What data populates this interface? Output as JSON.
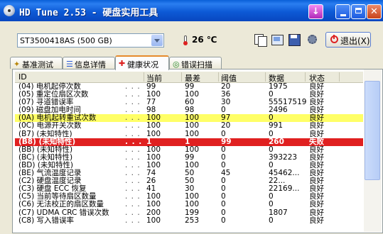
{
  "window": {
    "title": "HD Tune 2.53 - 硬盘实用工具",
    "icon": "disk-icon",
    "colors": {
      "titlebar": "#0a5fd8",
      "accent": "#e68b2c",
      "highlight_warn": "#ffff66",
      "highlight_bad": "#e02020"
    }
  },
  "toolbar": {
    "drive": "ST3500418AS (500 GB)",
    "temperature": "26 ℃",
    "exit_label": "退出(X)"
  },
  "tabs": [
    {
      "label": "基准测试",
      "icon": "benchmark-icon"
    },
    {
      "label": "信息详情",
      "icon": "info-icon"
    },
    {
      "label": "健康状况",
      "icon": "health-icon",
      "active": true
    },
    {
      "label": "错误扫描",
      "icon": "scan-icon"
    }
  ],
  "table": {
    "columns": [
      "ID",
      "当前",
      "最差",
      "阈值",
      "数据",
      "状态"
    ],
    "rows": [
      {
        "id": "(04) 电机起停次数",
        "cur": "99",
        "worst": "99",
        "thr": "20",
        "data": "1975",
        "status": "良好",
        "hl": ""
      },
      {
        "id": "(05) 重定位扇区次数",
        "cur": "100",
        "worst": "100",
        "thr": "36",
        "data": "0",
        "status": "良好",
        "hl": ""
      },
      {
        "id": "(07) 寻道错误率",
        "cur": "77",
        "worst": "60",
        "thr": "30",
        "data": "55517519",
        "status": "良好",
        "hl": ""
      },
      {
        "id": "(09) 磁盘加电时间",
        "cur": "98",
        "worst": "98",
        "thr": "0",
        "data": "2496",
        "status": "良好",
        "hl": ""
      },
      {
        "id": "(0A) 电机起转重试次数",
        "cur": "100",
        "worst": "100",
        "thr": "97",
        "data": "0",
        "status": "良好",
        "hl": "yellow"
      },
      {
        "id": "(0C) 电源开关次数",
        "cur": "100",
        "worst": "100",
        "thr": "20",
        "data": "991",
        "status": "良好",
        "hl": ""
      },
      {
        "id": "(B7) (未知特性)",
        "cur": "100",
        "worst": "100",
        "thr": "0",
        "data": "0",
        "status": "良好",
        "hl": ""
      },
      {
        "id": "(B8) (未知特性)",
        "cur": "1",
        "worst": "1",
        "thr": "99",
        "data": "260",
        "status": "失败",
        "hl": "red"
      },
      {
        "id": "(BB) (未知特性)",
        "cur": "100",
        "worst": "100",
        "thr": "0",
        "data": "0",
        "status": "良好",
        "hl": ""
      },
      {
        "id": "(BC) (未知特性)",
        "cur": "100",
        "worst": "99",
        "thr": "0",
        "data": "393223",
        "status": "良好",
        "hl": ""
      },
      {
        "id": "(BD) (未知特性)",
        "cur": "100",
        "worst": "100",
        "thr": "0",
        "data": "0",
        "status": "良好",
        "hl": ""
      },
      {
        "id": "(BE) 气流温度记录",
        "cur": "74",
        "worst": "50",
        "thr": "45",
        "data": "45462...",
        "status": "良好",
        "hl": ""
      },
      {
        "id": "(C2) 硬盘温度记录",
        "cur": "26",
        "worst": "50",
        "thr": "0",
        "data": "22...",
        "status": "良好",
        "hl": ""
      },
      {
        "id": "(C3) 硬盘 ECC 恢复",
        "cur": "41",
        "worst": "30",
        "thr": "0",
        "data": "22169...",
        "status": "良好",
        "hl": ""
      },
      {
        "id": "(C5) 当前等待扇区数量",
        "cur": "100",
        "worst": "100",
        "thr": "0",
        "data": "0",
        "status": "良好",
        "hl": ""
      },
      {
        "id": "(C6) 无法校正的扇区数量",
        "cur": "100",
        "worst": "100",
        "thr": "0",
        "data": "0",
        "status": "良好",
        "hl": ""
      },
      {
        "id": "(C7) UDMA CRC 错误次数",
        "cur": "200",
        "worst": "199",
        "thr": "0",
        "data": "1807",
        "status": "良好",
        "hl": ""
      },
      {
        "id": "(C8) 写入错误率",
        "cur": "100",
        "worst": "253",
        "thr": "0",
        "data": "0",
        "status": "良好",
        "hl": ""
      }
    ]
  }
}
